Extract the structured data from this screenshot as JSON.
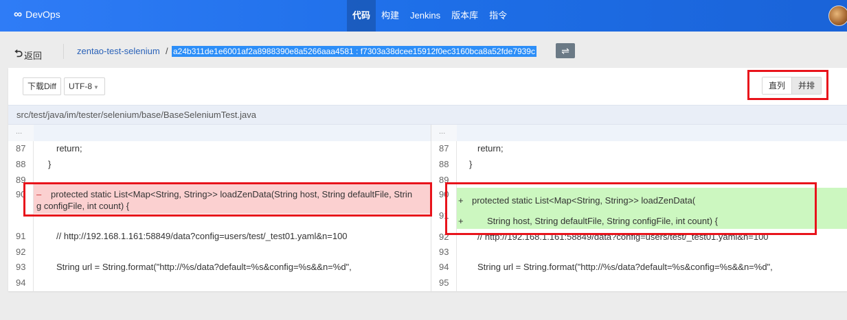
{
  "app": {
    "brand": "DevOps",
    "brand_icon": "infinity-icon",
    "accent_color": "#2f7cf6"
  },
  "nav": {
    "items": [
      {
        "label": "代码",
        "active": true
      },
      {
        "label": "构建",
        "active": false
      },
      {
        "label": "Jenkins",
        "active": false
      },
      {
        "label": "版本库",
        "active": false
      },
      {
        "label": "指令",
        "active": false
      }
    ]
  },
  "breadcrumb": {
    "back_label": "返回",
    "repo": "zentao-test-selenium",
    "slash": "/",
    "revisions": "a24b311de1e6001af2a8988390e8a5266aaa4581 : f7303a38dcee15912f0ec3160bca8a52fde7939c",
    "swap_icon": "swap-icon"
  },
  "toolbar": {
    "download_label": "下载Diff",
    "encoding_value": "UTF-8",
    "view_inline_label": "直列",
    "view_sidebyside_label": "并排",
    "active_view": "并排"
  },
  "file": {
    "path": "src/test/java/im/tester/selenium/base/BaseSeleniumTest.java"
  },
  "diff": {
    "ellipsis": "...",
    "left": {
      "lines": [
        {
          "num": "87",
          "code": "return;"
        },
        {
          "num": "88",
          "code": "}"
        },
        {
          "num": "89",
          "code": ""
        },
        {
          "num": "90",
          "marker": "–",
          "code": "protected static List<Map<String, String>> loadZenData(String host, String defaultFile, Strin",
          "code_wrap": "g configFile, int count) {"
        },
        {
          "num": "91",
          "code": "// http://192.168.1.161:58849/data?config=users/test/_test01.yaml&n=100"
        },
        {
          "num": "92",
          "code": ""
        },
        {
          "num": "93",
          "code": "String url = String.format(\"http://%s/data?default=%s&config=%s&&n=%d\","
        },
        {
          "num": "94",
          "code": ""
        }
      ]
    },
    "right": {
      "lines": [
        {
          "num": "87",
          "code": "return;"
        },
        {
          "num": "88",
          "code": "}"
        },
        {
          "num": "89",
          "code": ""
        },
        {
          "num": "90",
          "marker": "+",
          "code": "protected static List<Map<String, String>> loadZenData("
        },
        {
          "num": "91",
          "marker": "+",
          "code": "String host, String defaultFile, String configFile, int count) {"
        },
        {
          "num": "92",
          "code": "// http://192.168.1.161:58849/data?config=users/test/_test01.yaml&n=100"
        },
        {
          "num": "93",
          "code": ""
        },
        {
          "num": "94",
          "code": "String url = String.format(\"http://%s/data?default=%s&config=%s&&n=%d\","
        },
        {
          "num": "95",
          "code": ""
        }
      ]
    }
  }
}
